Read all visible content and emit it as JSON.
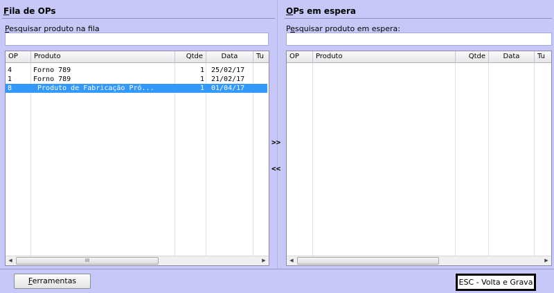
{
  "left_panel": {
    "title_accel": "F",
    "title_rest": "ila de OPs",
    "search_label_accel": "P",
    "search_label_rest": "esquisar produto na fila",
    "search_value": "",
    "columns": [
      "OP",
      "Produto",
      "Qtde",
      "Data",
      "Tu"
    ],
    "rows": [
      {
        "op": "4",
        "produto": "Forno 789",
        "qtde": "1",
        "data": "25/02/17",
        "tu": "",
        "selected": false
      },
      {
        "op": "1",
        "produto": "Forno 789",
        "qtde": "1",
        "data": "21/02/17",
        "tu": "",
        "selected": false
      },
      {
        "op": "8",
        "produto": " Produto de Fabricação Pró...",
        "qtde": "1",
        "data": "01/04/17",
        "tu": "",
        "selected": true
      }
    ],
    "scroll_grip": "III"
  },
  "right_panel": {
    "title_accel": "O",
    "title_rest": "Ps em espera",
    "search_label_before": "P",
    "search_label_accel": "e",
    "search_label_rest": "squisar produto em espera:",
    "search_value": "",
    "columns": [
      "OP",
      "Produto",
      "Qtde",
      "Data",
      "Tu"
    ]
  },
  "controls": {
    "move_right": ">>",
    "move_left": "<<"
  },
  "footer": {
    "tools_accel": "F",
    "tools_rest": "erramentas",
    "esc_label": "ESC - Volta e Grava"
  },
  "icons": {
    "scroll_left": "scroll-left-arrow-icon",
    "scroll_right": "scroll-right-arrow-icon"
  }
}
